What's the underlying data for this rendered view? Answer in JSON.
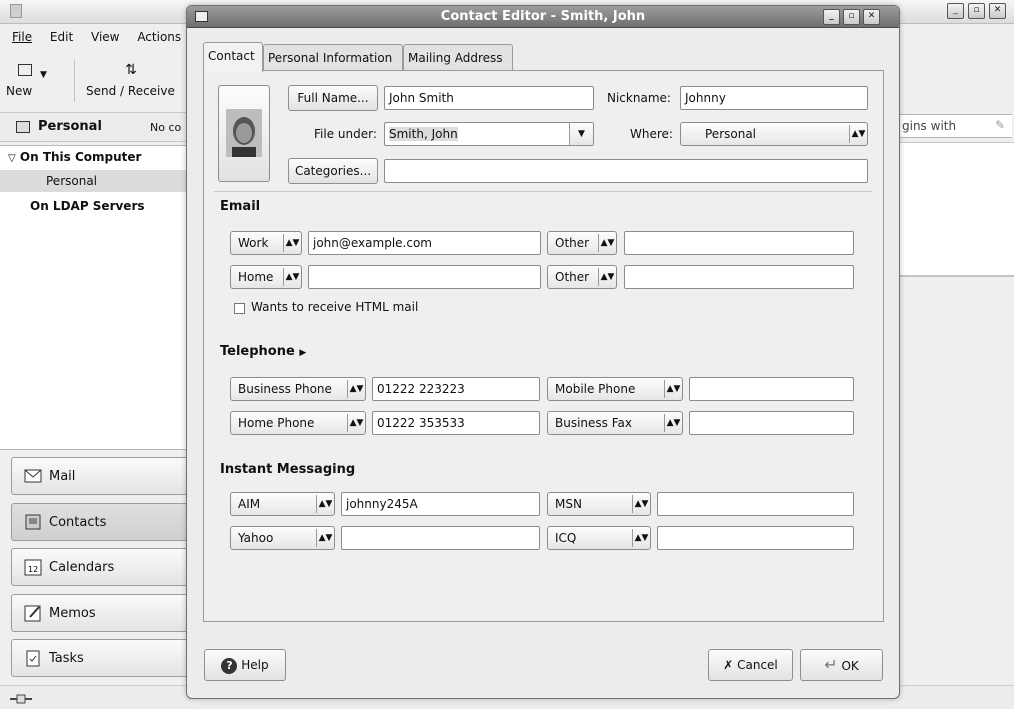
{
  "main": {
    "menu": [
      "File",
      "Edit",
      "View",
      "Actions"
    ],
    "toolbar": {
      "new_label": "New",
      "send_receive_label": "Send / Receive"
    },
    "sidebar_title": "Personal",
    "sidebar_count": "No co",
    "tree": [
      {
        "label": "On This Computer",
        "expanded": true
      },
      {
        "label": "Personal",
        "selected": true
      },
      {
        "label": "On LDAP Servers"
      }
    ],
    "switcher": [
      "Mail",
      "Contacts",
      "Calendars",
      "Memos",
      "Tasks"
    ],
    "search_partial": "gins with"
  },
  "dialog": {
    "title": "Contact Editor - Smith, John",
    "tabs": [
      "Contact",
      "Personal Information",
      "Mailing Address"
    ],
    "full_name_button": "Full Name...",
    "full_name": "John Smith",
    "nickname_label": "Nickname:",
    "nickname": "Johnny",
    "file_under_label": "File under:",
    "file_under": "Smith, John",
    "where_label": "Where:",
    "where": "Personal",
    "categories_button": "Categories...",
    "categories": "",
    "email": {
      "section": "Email",
      "rows": [
        {
          "type1": "Work",
          "value1": "john@example.com",
          "type2": "Other",
          "value2": ""
        },
        {
          "type1": "Home",
          "value1": "",
          "type2": "Other",
          "value2": ""
        }
      ],
      "html_mail_label": "Wants to receive HTML mail",
      "html_mail_checked": false
    },
    "telephone": {
      "section": "Telephone",
      "rows": [
        {
          "type1": "Business Phone",
          "value1": "01222 223223",
          "type2": "Mobile Phone",
          "value2": ""
        },
        {
          "type1": "Home Phone",
          "value1": "01222 353533",
          "type2": "Business Fax",
          "value2": ""
        }
      ]
    },
    "im": {
      "section": "Instant Messaging",
      "rows": [
        {
          "type1": "AIM",
          "value1": "johnny245A",
          "type2": "MSN",
          "value2": ""
        },
        {
          "type1": "Yahoo",
          "value1": "",
          "type2": "ICQ",
          "value2": ""
        }
      ]
    },
    "help_button": "Help",
    "cancel_button": "Cancel",
    "ok_button": "OK"
  },
  "colors": {
    "title_bar": "#7a7a7a",
    "panel": "#efefef",
    "selection": "#dcdcdc"
  }
}
